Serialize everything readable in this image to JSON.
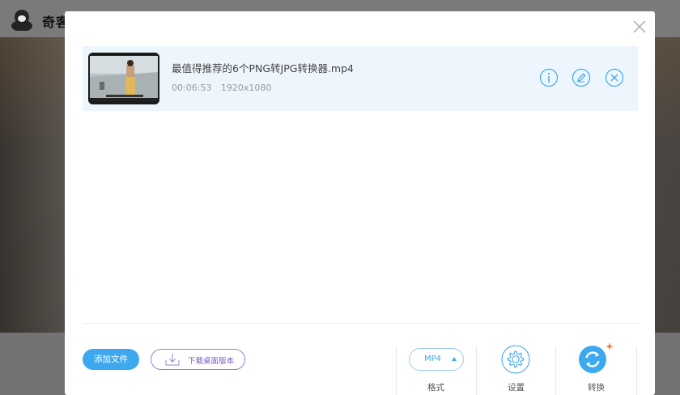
{
  "background": {
    "app_title": "奇客"
  },
  "file": {
    "name": "最值得推荐的6个PNG转JPG转换器.mp4",
    "duration": "00:06:53",
    "resolution": "1920x1080"
  },
  "footer": {
    "add_file_label": "添加文件",
    "download_desktop_label": "下载桌面版本",
    "format_value": "MP4",
    "format_label": "格式",
    "settings_label": "设置",
    "convert_label": "转换"
  },
  "colors": {
    "accent": "#3ea8ef",
    "row_highlight": "#eef6fd",
    "download_border": "#9a7fcf",
    "spark": "#f0613a"
  }
}
